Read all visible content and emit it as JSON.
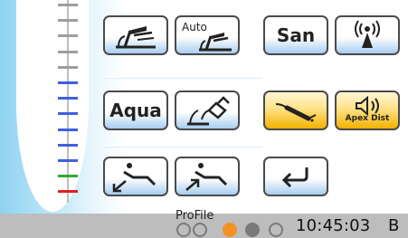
{
  "gauge": {
    "ticks": [
      {
        "color": "#9e9e9e"
      },
      {
        "color": "#9e9e9e"
      },
      {
        "color": "#9e9e9e"
      },
      {
        "color": "#9e9e9e"
      },
      {
        "color": "#9e9e9e"
      },
      {
        "color": "#3f5fe0"
      },
      {
        "color": "#3f5fe0"
      },
      {
        "color": "#3f5fe0"
      },
      {
        "color": "#3f5fe0"
      },
      {
        "color": "#3f5fe0"
      },
      {
        "color": "#3f5fe0"
      },
      {
        "color": "#2faa2f"
      },
      {
        "color": "#e02020"
      }
    ]
  },
  "buttons": {
    "instrument": {
      "icon": "handpiece-instrument-icon"
    },
    "auto_instrument": {
      "label": "Auto",
      "icon": "handpiece-instrument-icon"
    },
    "san": {
      "label": "San"
    },
    "wireless": {
      "icon": "wireless-signal-icon"
    },
    "aqua": {
      "label": "Aqua"
    },
    "rinse": {
      "icon": "cup-rinse-icon"
    },
    "scaler": {
      "icon": "scaler-handpiece-icon"
    },
    "apex": {
      "label": "Apex Dist",
      "icon": "speaker-icon"
    },
    "chair_down": {
      "icon": "chair-recline-down-icon"
    },
    "chair_up": {
      "icon": "chair-recline-up-icon"
    },
    "back": {
      "icon": "return-arrow-icon"
    }
  },
  "status_bar": {
    "profile_label": "ProFile",
    "dots": [
      {
        "state": "empty",
        "color": "#bdbdbd"
      },
      {
        "state": "empty",
        "color": "#bdbdbd"
      },
      {
        "state": "active",
        "color": "#f39222"
      },
      {
        "state": "filled",
        "color": "#7a7a7a"
      },
      {
        "state": "empty",
        "color": "#bdbdbd"
      }
    ],
    "time": "10:45:03",
    "mode": "B"
  },
  "colors": {
    "button_yellow": "#ffe28a",
    "button_blue": "#a9cdf0",
    "accent_orange": "#f39222"
  }
}
